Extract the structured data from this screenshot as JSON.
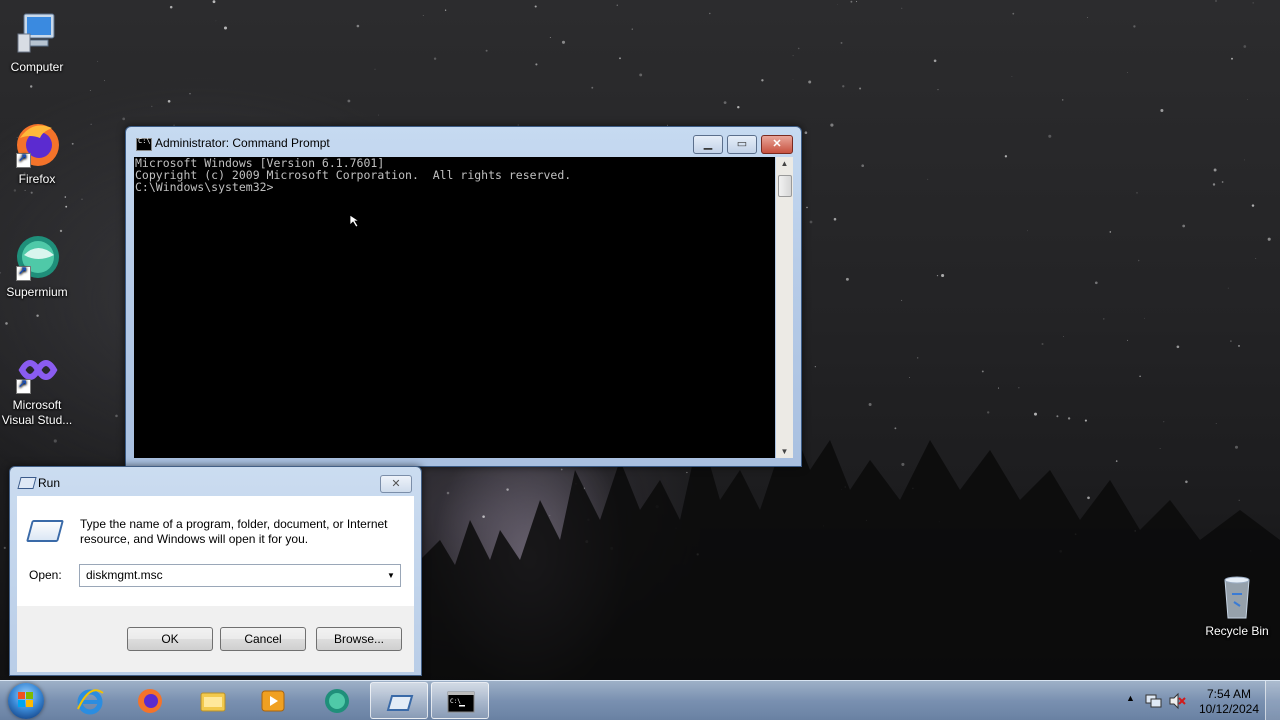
{
  "desktop": {
    "icons": [
      {
        "label": "Computer",
        "icon": "computer-icon"
      },
      {
        "label": "Firefox",
        "icon": "firefox-icon"
      },
      {
        "label": "Supermium",
        "icon": "supermium-icon"
      },
      {
        "label": "Microsoft Visual Stud...",
        "icon": "visual-studio-icon"
      },
      {
        "label": "Recycle Bin",
        "icon": "recycle-bin-icon"
      }
    ]
  },
  "cmd": {
    "title": "Administrator: Command Prompt",
    "lines": [
      "Microsoft Windows [Version 6.1.7601]",
      "Copyright (c) 2009 Microsoft Corporation.  All rights reserved.",
      "",
      "C:\\Windows\\system32>"
    ],
    "controls": {
      "minimize": "minimize-icon",
      "maximize": "maximize-icon",
      "close": "close-icon"
    }
  },
  "run": {
    "title": "Run",
    "description": "Type the name of a program, folder, document, or Internet resource, and Windows will open it for you.",
    "open_label": "Open:",
    "open_value": "diskmgmt.msc",
    "buttons": {
      "ok": "OK",
      "cancel": "Cancel",
      "browse": "Browse..."
    }
  },
  "taskbar": {
    "items": [
      {
        "name": "internet-explorer-icon"
      },
      {
        "name": "firefox-icon"
      },
      {
        "name": "windows-explorer-icon"
      },
      {
        "name": "media-player-icon"
      },
      {
        "name": "supermium-icon"
      },
      {
        "name": "run-dialog-icon",
        "active": true
      },
      {
        "name": "command-prompt-icon",
        "active": true
      }
    ],
    "clock": {
      "time": "7:54 AM",
      "date": "10/12/2024"
    }
  },
  "colors": {
    "cmd_text": "#c0c0c0",
    "cmd_bg": "#000000",
    "titlebar": "#b9cde7",
    "close_button": "#c75240"
  }
}
